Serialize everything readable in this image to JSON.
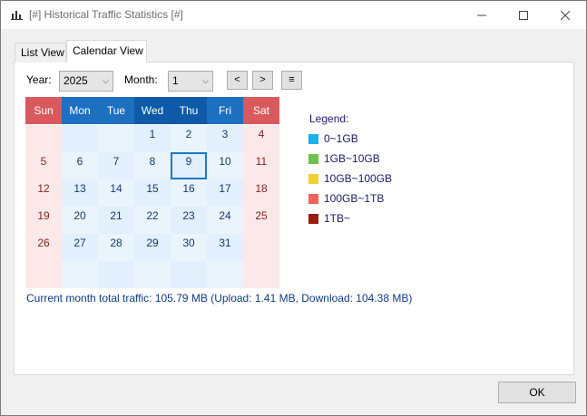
{
  "window": {
    "title": "[#] Historical Traffic Statistics [#]",
    "controls": {
      "minimize": "—",
      "maximize": "☐",
      "close": "✕"
    }
  },
  "tabs": [
    {
      "label": "List View",
      "active": false
    },
    {
      "label": "Calendar View",
      "active": true
    }
  ],
  "filters": {
    "year_label": "Year:",
    "year_value": "2025",
    "month_label": "Month:",
    "month_value": "1",
    "prev_label": "<",
    "next_label": ">",
    "menu_label": "≡"
  },
  "calendar": {
    "weekdays": [
      "Sun",
      "Mon",
      "Tue",
      "Wed",
      "Thu",
      "Fri",
      "Sat"
    ],
    "header_colors": [
      "#d85a5d",
      "#1d6fbf",
      "#1d6fbf",
      "#0e5aa8",
      "#0e5aa8",
      "#1d6fbf",
      "#d85a5d"
    ],
    "weeks": [
      [
        "",
        "",
        "",
        "1",
        "2",
        "3",
        "4"
      ],
      [
        "5",
        "6",
        "7",
        "8",
        "9",
        "10",
        "11"
      ],
      [
        "12",
        "13",
        "14",
        "15",
        "16",
        "17",
        "18"
      ],
      [
        "19",
        "20",
        "21",
        "22",
        "23",
        "24",
        "25"
      ],
      [
        "26",
        "27",
        "28",
        "29",
        "30",
        "31",
        ""
      ],
      [
        "",
        "",
        "",
        "",
        "",
        "",
        ""
      ]
    ],
    "selected_day": "9",
    "traffic_days": [
      {
        "day": "9",
        "level": "0~1GB"
      }
    ],
    "weekend_bg": "#fbe9e9",
    "weekday_bg": "#e2effc",
    "weekday_bg_alt": "#eaf4fd"
  },
  "legend": {
    "title": "Legend:",
    "items": [
      {
        "label": "0~1GB",
        "color": "#1ab2e8"
      },
      {
        "label": "1GB~10GB",
        "color": "#6cc24a"
      },
      {
        "label": "10GB~100GB",
        "color": "#f2d130"
      },
      {
        "label": "100GB~1TB",
        "color": "#f2625a"
      },
      {
        "label": "1TB~",
        "color": "#9b1b0e"
      }
    ]
  },
  "summary": "Current month total traffic: 105.79 MB (Upload: 1.41 MB, Download: 104.38 MB)",
  "ok_label": "OK"
}
